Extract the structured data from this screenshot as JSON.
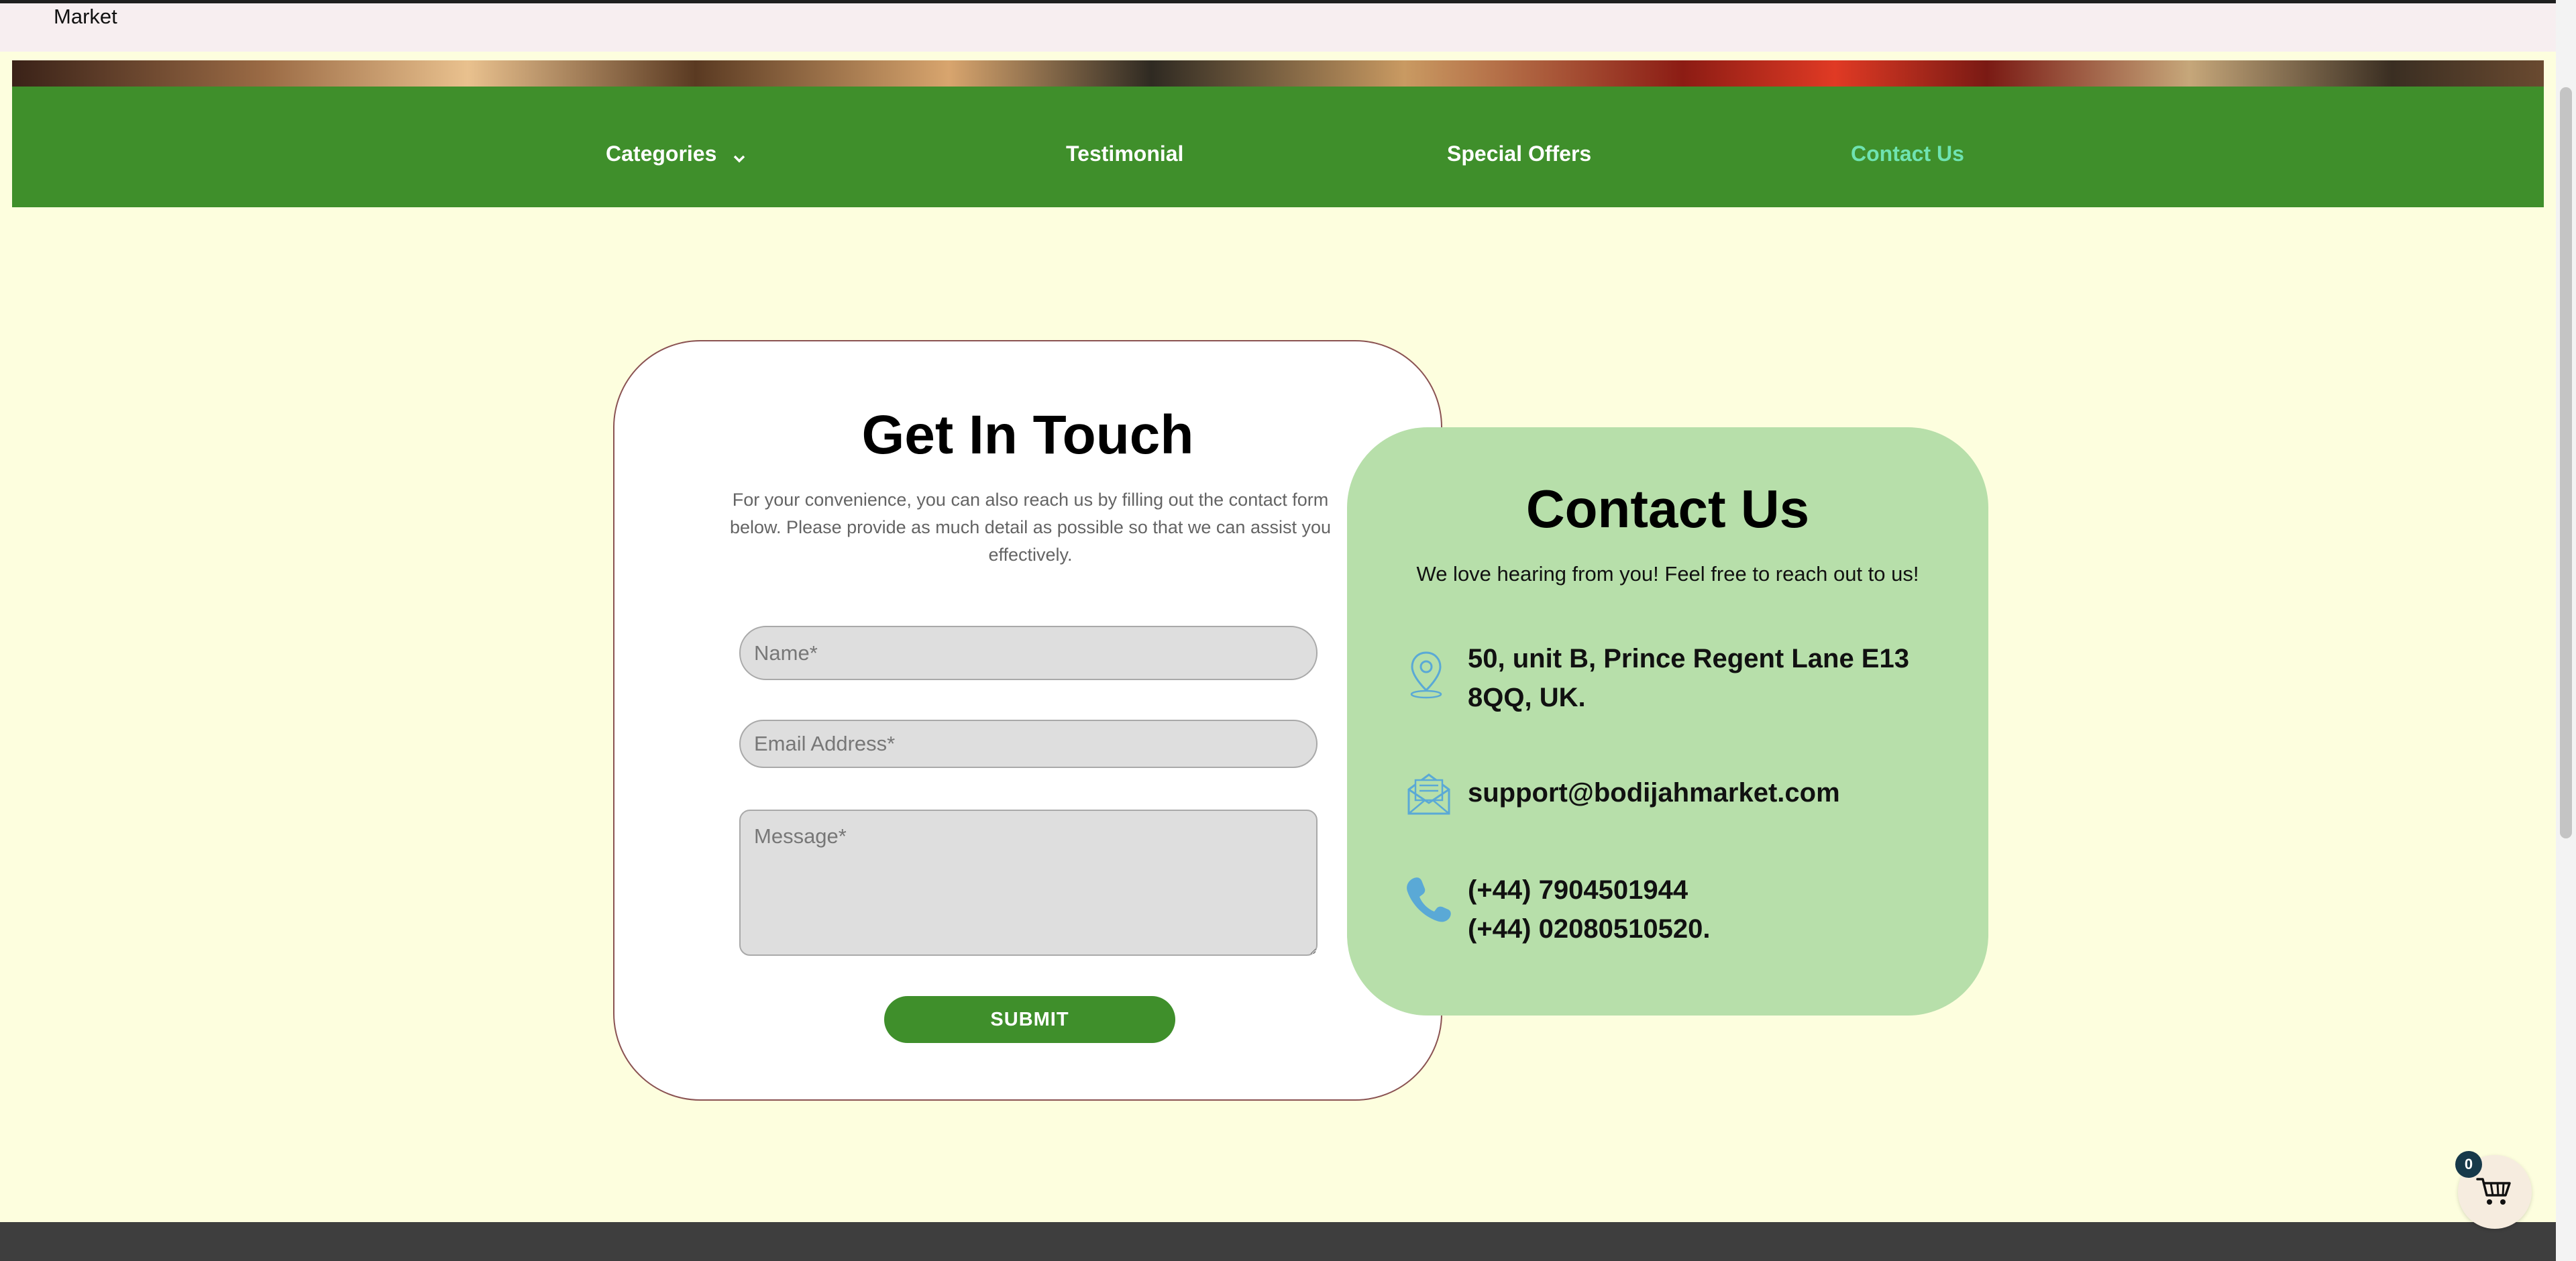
{
  "header": {
    "brand_text": "Market"
  },
  "nav": {
    "items": [
      {
        "label": "Categories"
      },
      {
        "label": "Testimonial"
      },
      {
        "label": "Special Offers"
      },
      {
        "label": "Contact Us",
        "active": true
      }
    ]
  },
  "form": {
    "title": "Get In Touch",
    "description": "For your convenience, you can also reach us by filling out the contact form below. Please provide as much detail as possible so that we can assist you effectively.",
    "name_placeholder": "Name*",
    "email_placeholder": "Email Address*",
    "message_placeholder": "Message*",
    "submit_label": "SUBMIT"
  },
  "contact": {
    "title": "Contact Us",
    "subtitle": "We love hearing from you! Feel free to reach out to us!",
    "address": "50, unit B, Prince Regent Lane E13 8QQ, UK.",
    "email": "support@bodijahmarket.com",
    "phone_1": "(+44) 7904501944",
    "phone_2": "(+44) 02080510520."
  },
  "cart": {
    "count": "0",
    "icon": "cart-icon"
  },
  "icons": {
    "location": "location-pin-icon",
    "mail": "envelope-icon",
    "phone": "phone-icon",
    "chevron": "chevron-down-icon"
  },
  "colors": {
    "nav_green": "#3f8f2b",
    "active_link": "#6fe3b1",
    "contact_card": "#b7dfaa",
    "page_bg": "#fdfede",
    "icon_blue": "#5aa9d6"
  }
}
